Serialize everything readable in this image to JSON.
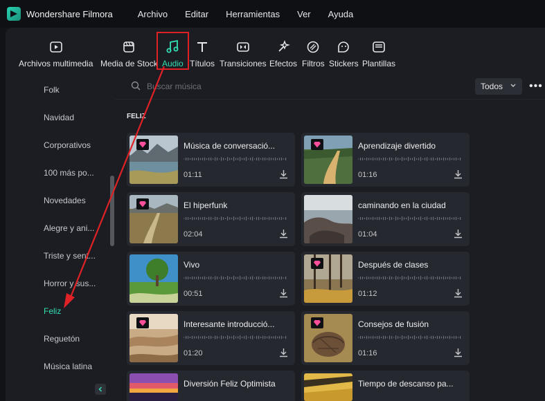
{
  "app": {
    "name": "Wondershare Filmora"
  },
  "menu": [
    "Archivo",
    "Editar",
    "Herramientas",
    "Ver",
    "Ayuda"
  ],
  "toolbar": {
    "tabs": [
      {
        "label": "Archivos multimedia",
        "icon": "play-icon"
      },
      {
        "label": "Media de Stock",
        "icon": "stock-icon"
      },
      {
        "label": "Audio",
        "icon": "music-note-icon",
        "active": true
      },
      {
        "label": "Títulos",
        "icon": "text-icon"
      },
      {
        "label": "Transiciones",
        "icon": "transitions-icon"
      },
      {
        "label": "Efectos",
        "icon": "effects-icon"
      },
      {
        "label": "Filtros",
        "icon": "filter-icon"
      },
      {
        "label": "Stickers",
        "icon": "sticker-icon"
      },
      {
        "label": "Plantillas",
        "icon": "template-icon"
      }
    ]
  },
  "sidebar": {
    "items": [
      {
        "label": "Folk"
      },
      {
        "label": "Navidad"
      },
      {
        "label": "Corporativos"
      },
      {
        "label": "100 más po..."
      },
      {
        "label": "Novedades"
      },
      {
        "label": "Alegre y ani..."
      },
      {
        "label": "Triste y sent..."
      },
      {
        "label": "Horror y sus..."
      },
      {
        "label": "Feliz",
        "active": true
      },
      {
        "label": "Reguetón"
      },
      {
        "label": "Música latina"
      }
    ]
  },
  "search": {
    "placeholder": "Buscar música"
  },
  "filter": {
    "value": "Todos"
  },
  "section": {
    "title": "FELIZ"
  },
  "tracks": [
    {
      "title": "Música de conversació...",
      "duration": "01:11",
      "premium": true,
      "thumb": "lake"
    },
    {
      "title": "Aprendizaje divertido",
      "duration": "01:16",
      "premium": true,
      "thumb": "road"
    },
    {
      "title": "El hiperfunk",
      "duration": "02:04",
      "premium": true,
      "thumb": "field"
    },
    {
      "title": "caminando en la ciudad",
      "duration": "01:04",
      "premium": false,
      "thumb": "rocks"
    },
    {
      "title": "Vivo",
      "duration": "00:51",
      "premium": false,
      "thumb": "tree"
    },
    {
      "title": "Después de clases",
      "duration": "01:12",
      "premium": true,
      "thumb": "trees"
    },
    {
      "title": "Interesante introducció...",
      "duration": "01:20",
      "premium": true,
      "thumb": "dunes"
    },
    {
      "title": "Consejos de fusión",
      "duration": "01:16",
      "premium": true,
      "thumb": "ball"
    },
    {
      "title": "Diversión Feliz Optimista",
      "duration": "",
      "premium": false,
      "thumb": "sunset"
    },
    {
      "title": "Tiempo de descanso pa...",
      "duration": "",
      "premium": false,
      "thumb": "sand"
    }
  ],
  "colors": {
    "accent": "#33e0b4",
    "highlight": "#e02226",
    "premium": "#ff4f9a"
  }
}
